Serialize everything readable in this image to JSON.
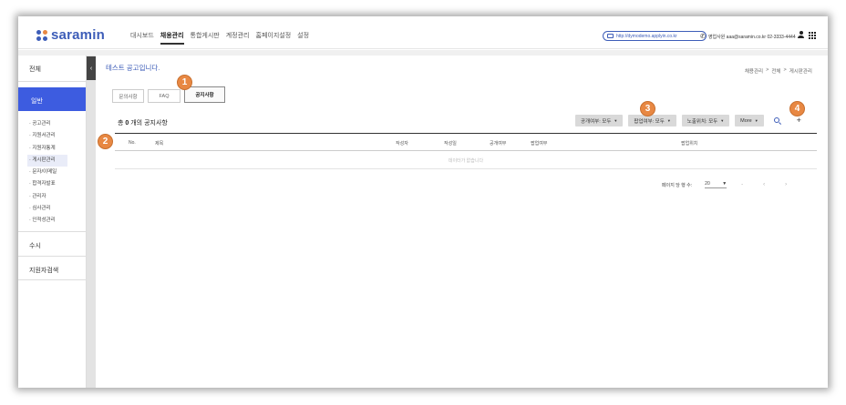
{
  "topbar": {
    "logo_text": "saramin",
    "logo_dot_colors": [
      "#3d5db8",
      "#e88843",
      "#3d5db8",
      "#3d5db8"
    ],
    "nav": [
      "대시보드",
      "채용관리",
      "통합게시판",
      "계정관리",
      "홈페이지설정",
      "설정"
    ],
    "nav_active_index": 1,
    "url": "http://dymodemo.applyin.co.kr",
    "contact": "영업사원 aaa@saramin.co.kr 02-3333-4444"
  },
  "sidebar": {
    "top_label": "전체",
    "active_label": "일반",
    "sub_items": [
      "· 공고관리",
      "· 지원서관리",
      "· 지원자통계",
      "· 게시판관리",
      "· 문자/이메일",
      "· 합격자발표",
      "· 관리자",
      "· 심사관리",
      "· 인적성관리"
    ],
    "current_sub_index": 3,
    "sections": [
      "수시",
      "지원자검색"
    ],
    "collapse_glyph": "‹"
  },
  "content": {
    "page_title": "테스트 공고입니다.",
    "breadcrumb": [
      "채용관리",
      ">",
      "전체",
      ">",
      "게시판관리"
    ],
    "tabs": [
      "문의사항",
      "FAQ",
      "공지사항"
    ],
    "active_tab_index": 2,
    "count_prefix": "총 ",
    "count_value": "0",
    "count_suffix": " 개의 공지사항",
    "filters": [
      "공개여부: 모두",
      "팝업여부: 모두",
      "노출위치: 모두",
      "More"
    ],
    "caret": "▼",
    "plus": "+",
    "table_headers": [
      "No.",
      "제목",
      "작성자",
      "작성일",
      "공개여부",
      "팝업여부",
      "팝업위치"
    ],
    "empty_message": "데이터가 없습니다",
    "pager_label": "페이지 당 행 수:",
    "page_size": "20",
    "pager_dash": "-",
    "prev": "‹",
    "next": "›"
  },
  "badges": [
    "1",
    "2",
    "3",
    "4"
  ],
  "colors": {
    "brand": "#3d5db8",
    "sidebar_active": "#3d5ce0",
    "badge": "#e88843"
  }
}
